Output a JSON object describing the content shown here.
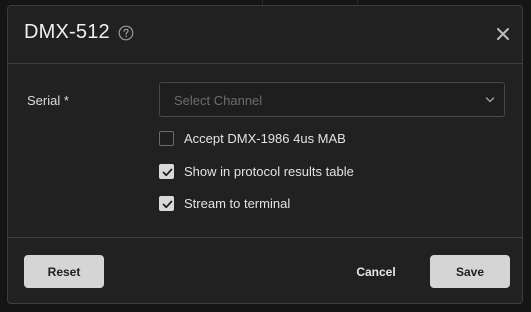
{
  "dialog": {
    "title": "DMX-512",
    "help_icon": "question-circle-icon",
    "close_icon": "close-x-icon"
  },
  "form": {
    "serial_label": "Serial *",
    "serial_select": {
      "placeholder": "Select Channel",
      "value": ""
    },
    "checkboxes": [
      {
        "label": "Accept DMX-1986 4us MAB",
        "checked": false
      },
      {
        "label": "Show in protocol results table",
        "checked": true
      },
      {
        "label": "Stream to terminal",
        "checked": true
      }
    ]
  },
  "footer": {
    "reset_label": "Reset",
    "cancel_label": "Cancel",
    "save_label": "Save"
  },
  "colors": {
    "background": "#151515",
    "dialog_bg": "#212121",
    "button_bg": "#d5d5d5",
    "checkbox_on": "#d9d9d9"
  }
}
